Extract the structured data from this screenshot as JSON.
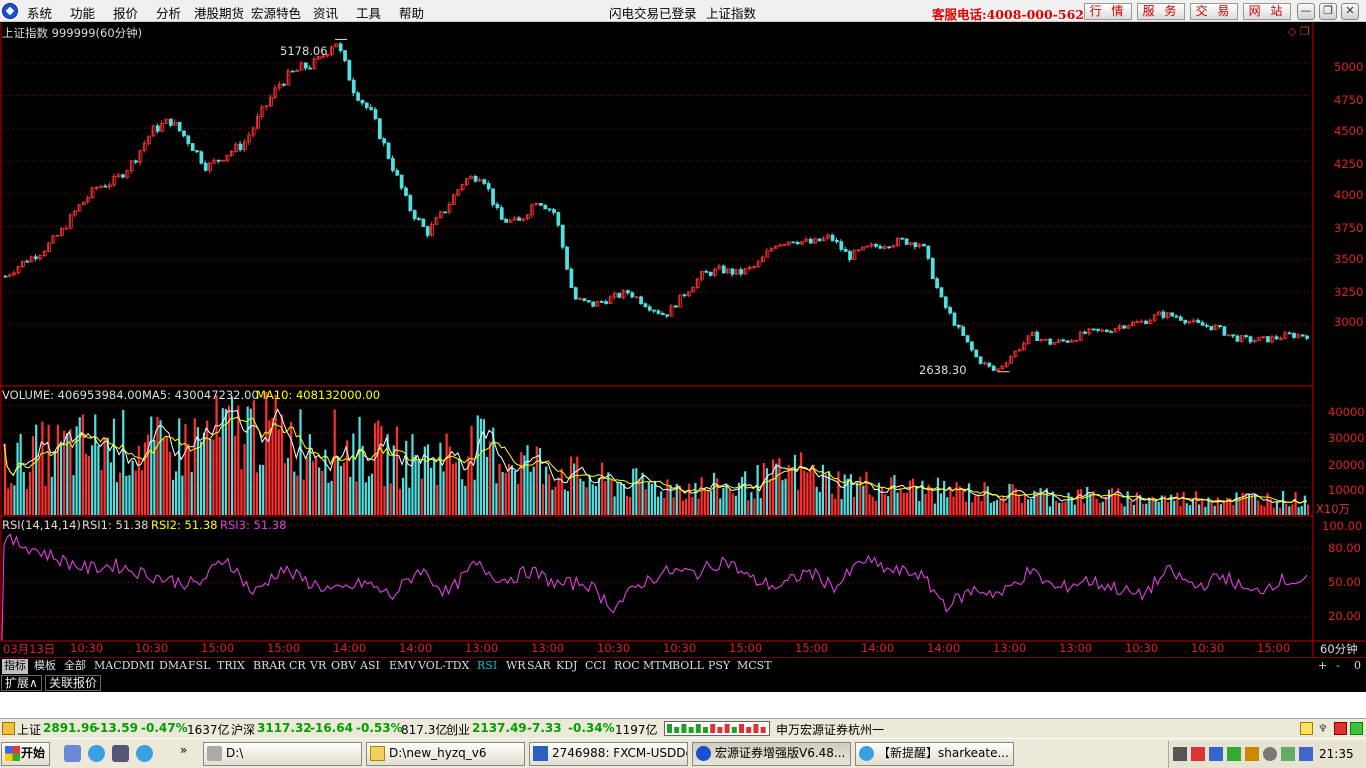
{
  "menu": {
    "items": [
      "系统",
      "功能",
      "报价",
      "分析",
      "港股期货",
      "宏源特色",
      "资讯",
      "工具",
      "帮助"
    ],
    "status_left": "闪电交易已登录",
    "status_right": "上证指数",
    "hotline": "客服电话:4008-000-562",
    "buttons": [
      "行 情",
      "服 务",
      "交 易",
      "网 站"
    ],
    "window_controls": [
      "—",
      "❐",
      "✕"
    ]
  },
  "chart": {
    "title": "上证指数 999999(60分钟)",
    "high_label": "5178.06",
    "low_label": "2638.30",
    "price_ticks": [
      "5000",
      "4750",
      "4500",
      "4250",
      "4000",
      "3750",
      "3500",
      "3250",
      "3000"
    ],
    "volume": {
      "label": "VOLUME: 406953984.00",
      "ma5": "MA5: 430047232.00",
      "ma10": "MA10: 408132000.00",
      "ticks": [
        "40000",
        "30000",
        "20000",
        "10000"
      ],
      "unit": "X10万"
    },
    "rsi": {
      "label": "RSI(14,14,14)",
      "rsi1": "RSI1: 51.38",
      "rsi2": "RSI2: 51.38",
      "rsi3": "RSI3: 51.38",
      "ticks": [
        "100.00",
        "80.00",
        "50.00",
        "20.00"
      ]
    },
    "time_labels": [
      "03月13日",
      "10:30",
      "10:30",
      "15:00",
      "15:00",
      "14:00",
      "14:00",
      "13:00",
      "13:00",
      "10:30",
      "10:30",
      "15:00",
      "15:00",
      "14:00",
      "14:00",
      "13:00",
      "13:00",
      "10:30",
      "10:30",
      "15:00"
    ],
    "period": "60分钟",
    "colors": {
      "up": "#ff3030",
      "down": "#50e0e0",
      "ma5": "#ffffff",
      "ma10": "#ffff00",
      "rsi": "#e040e0",
      "axis": "#c00000"
    }
  },
  "chart_data": [
    {
      "type": "line",
      "title": "上证指数 999999(60分钟)",
      "annotations": [
        {
          "label": "5178.06",
          "kind": "high"
        },
        {
          "label": "2638.30",
          "kind": "low"
        }
      ],
      "ylim": [
        2600,
        5250
      ],
      "y": [
        3370,
        3480,
        3560,
        3700,
        3900,
        4050,
        4100,
        4250,
        4480,
        4560,
        4400,
        4200,
        4300,
        4380,
        4620,
        4850,
        4950,
        5000,
        5178,
        4800,
        4600,
        4250,
        3900,
        3700,
        3880,
        4100,
        4150,
        3800,
        3780,
        3960,
        3850,
        3200,
        3150,
        3200,
        3250,
        3150,
        3070,
        3230,
        3380,
        3420,
        3390,
        3450,
        3620,
        3650,
        3620,
        3670,
        3520,
        3580,
        3620,
        3640,
        3620,
        3200,
        2960,
        2740,
        2640,
        2780,
        2920,
        2860,
        2880,
        2940,
        2950,
        3000,
        3020,
        3080,
        3060,
        3000,
        2980,
        2900,
        2880,
        2890,
        2920,
        2920
      ],
      "series": [
        {
          "name": "上证指数"
        }
      ]
    },
    {
      "type": "bar",
      "series": [
        {
          "name": "VOLUME"
        },
        {
          "name": "MA5"
        },
        {
          "name": "MA10"
        }
      ],
      "ylim": [
        0,
        45000
      ],
      "y": [
        18000,
        22000,
        24000,
        26000,
        25000,
        23000,
        27000,
        30000,
        32000,
        28000,
        26000,
        24000,
        22000,
        20000,
        22000,
        24000,
        20000,
        18000,
        14000,
        12000,
        11000,
        10500,
        10000,
        10000,
        13000,
        16000,
        12000,
        11000,
        10000,
        9000,
        8500,
        8000,
        7500,
        7000,
        7000,
        6500,
        6000,
        6000,
        6500,
        6000,
        6000,
        5500
      ]
    },
    {
      "type": "line",
      "series": [
        {
          "name": "RSI1"
        },
        {
          "name": "RSI2"
        },
        {
          "name": "RSI3"
        }
      ],
      "ylim": [
        0,
        100
      ],
      "y": [
        88,
        80,
        70,
        62,
        65,
        58,
        52,
        48,
        72,
        40,
        62,
        50,
        42,
        50,
        38,
        62,
        40,
        66,
        52,
        60,
        48,
        50,
        28,
        50,
        60,
        58,
        70,
        52,
        46,
        60,
        46,
        70,
        60,
        58,
        30,
        44,
        40,
        60,
        44,
        52,
        46,
        38,
        60,
        46,
        56,
        40,
        52,
        51
      ]
    }
  ],
  "indicator_tabs": [
    "指标",
    "模板",
    "全部",
    "MACD",
    "DMI",
    "DMA",
    "FSL",
    "TRIX",
    "BRAR",
    "CR",
    "VR",
    "OBV",
    "ASI",
    "EMV",
    "VOL-TDX",
    "RSI",
    "WR",
    "SAR",
    "KDJ",
    "CCI",
    "ROC",
    "MTM",
    "BOLL",
    "PSY",
    "MCST"
  ],
  "indicator_selected": "RSI",
  "zoom_controls": [
    "+",
    "-",
    "0"
  ],
  "ext_tabs": [
    "扩展∧",
    "关联报价"
  ],
  "status": {
    "sh_name": "上证",
    "sh_val": "2891.96",
    "sh_chg": "-13.59",
    "sh_pct": "-0.47%",
    "sh_amt": "1637亿",
    "hs_name": "沪深",
    "hs_val": "3117.32",
    "hs_chg": "-16.64",
    "hs_pct": "-0.53%",
    "hs_amt": "817.3亿",
    "cy_name": "创业",
    "cy_val": "2137.49",
    "cy_chg": "-7.33",
    "cy_pct": "-0.34%",
    "cy_amt": "1197亿",
    "broker": "申万宏源证券杭州一"
  },
  "taskbar": {
    "start": "开始",
    "windows": [
      "D:\\",
      "D:\\new_hyzq_v6",
      "2746988: FXCM-USDDe...",
      "宏源证券增强版V6.48...",
      "【新提醒】sharkeate..."
    ],
    "clock": "21:35"
  }
}
